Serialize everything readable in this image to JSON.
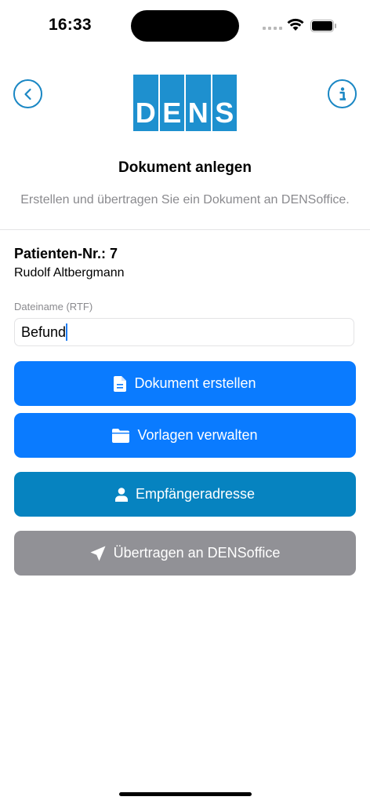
{
  "status_bar": {
    "time": "16:33"
  },
  "header": {
    "logo_letters": [
      "D",
      "E",
      "N",
      "S"
    ],
    "title": "Dokument anlegen",
    "subtitle": "Erstellen und übertragen Sie ein Dokument an DENSoffice.",
    "back_icon": "chevron-left-circle-icon",
    "info_icon": "info-circle-icon"
  },
  "patient": {
    "number_label": "Patienten-Nr.: 7",
    "name": "Rudolf Altbergmann"
  },
  "filename": {
    "label": "Dateiname (RTF)",
    "value": "Befund"
  },
  "buttons": {
    "create_document": {
      "label": "Dokument erstellen",
      "icon": "document-icon"
    },
    "manage_templates": {
      "label": "Vorlagen verwalten",
      "icon": "folder-icon"
    },
    "recipient_address": {
      "label": "Empfängeradresse",
      "icon": "person-icon"
    },
    "transfer": {
      "label": "Übertragen an DENSoffice",
      "icon": "paper-plane-icon"
    }
  },
  "colors": {
    "accent": "#0a7bff",
    "teal": "#0683c0",
    "disabled": "#919196",
    "logo": "#1e90cf"
  }
}
